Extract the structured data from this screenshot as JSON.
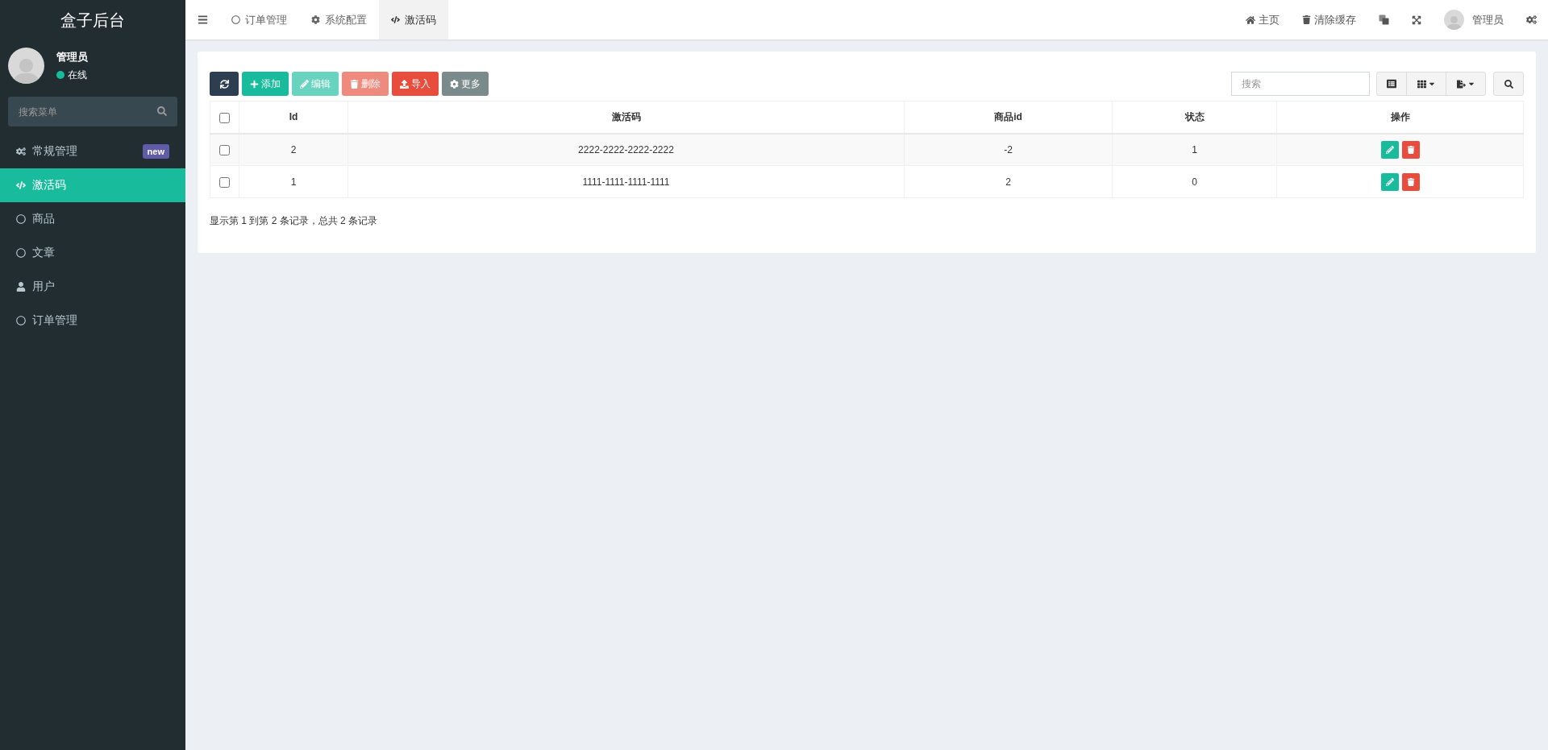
{
  "sidebar": {
    "logo": "盒子后台",
    "user": {
      "name": "管理员",
      "status": "在线"
    },
    "search": {
      "placeholder": "搜索菜单"
    },
    "items": [
      {
        "label": "常规管理",
        "kind": "group",
        "selected": false,
        "badge": "new"
      },
      {
        "label": "激活码",
        "kind": "code",
        "selected": true
      },
      {
        "label": "商品",
        "kind": "page",
        "selected": false
      },
      {
        "label": "文章",
        "kind": "page",
        "selected": false
      },
      {
        "label": "用户",
        "kind": "user",
        "selected": false
      },
      {
        "label": "订单管理",
        "kind": "page",
        "selected": false
      }
    ]
  },
  "tabs": [
    {
      "label": "订单管理",
      "kind": "page",
      "selected": false
    },
    {
      "label": "系统配置",
      "kind": "config",
      "selected": false
    },
    {
      "label": "激活码",
      "kind": "code",
      "selected": true
    }
  ],
  "topbar": {
    "home": "主页",
    "clear_cache": "清除缓存",
    "user": "管理员"
  },
  "toolbar": {
    "buttons": [
      {
        "kind": "refresh",
        "disabled": false
      },
      {
        "kind": "add",
        "label": "添加",
        "disabled": false
      },
      {
        "kind": "edit",
        "label": "编辑",
        "disabled": true
      },
      {
        "kind": "delete",
        "label": "删除",
        "disabled": true
      },
      {
        "kind": "import",
        "label": "导入",
        "disabled": false
      },
      {
        "kind": "more",
        "label": "更多",
        "disabled": false
      }
    ],
    "search": {
      "placeholder": "搜索"
    }
  },
  "table": {
    "select_all": {
      "checked": false
    },
    "columns": [
      "Id",
      "激活码",
      "商品id",
      "状态",
      "操作"
    ],
    "rows": [
      {
        "checked": false,
        "cells": [
          "2",
          "2222-2222-2222-2222",
          "-2",
          "1"
        ]
      },
      {
        "checked": false,
        "cells": [
          "1",
          "1111-1111-1111-1111",
          "2",
          "0"
        ]
      }
    ]
  },
  "pagination_info": "显示第 1 到第 2 条记录，总共 2 条记录"
}
